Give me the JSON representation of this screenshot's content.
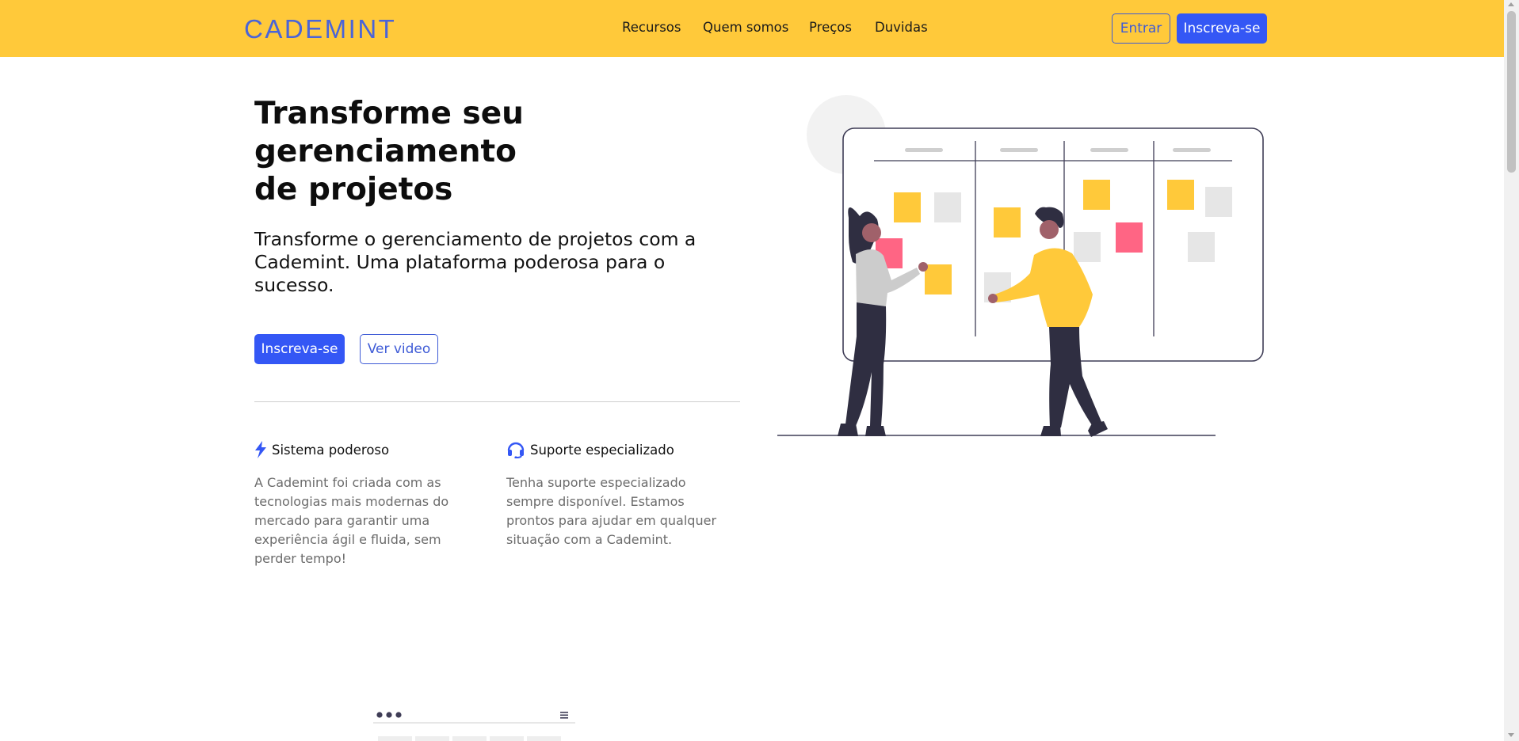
{
  "brand": {
    "logo": "CADEMINT"
  },
  "nav": {
    "links": [
      "Recursos",
      "Quem somos",
      "Preços",
      "Duvidas"
    ],
    "login_label": "Entrar",
    "signup_label": "Inscreva-se"
  },
  "hero": {
    "title": "Transforme seu\ngerenciamento\nde projetos",
    "subtitle": "Transforme o gerenciamento de projetos com a Cademint. Uma plataforma poderosa para o sucesso.",
    "primary_label": "Inscreva-se",
    "secondary_label": "Ver video"
  },
  "features": [
    {
      "icon": "lightning-icon",
      "title": "Sistema poderoso",
      "text": "A Cademint foi criada com as tecnologias mais modernas do mercado para garantir uma experiência ágil e fluida, sem perder tempo!"
    },
    {
      "icon": "headset-icon",
      "title": "Suporte especializado",
      "text": "Tenha suporte especializado sempre disponível. Estamos prontos para ajudar em qualquer situação com a Cademint."
    }
  ],
  "colors": {
    "navbar": "#FFC93A",
    "primary": "#3457f5",
    "logo": "#4a64d8",
    "sticky_yellow": "#FFC93A",
    "sticky_pink": "#FF6584",
    "sticky_gray": "#E6E6E6"
  }
}
